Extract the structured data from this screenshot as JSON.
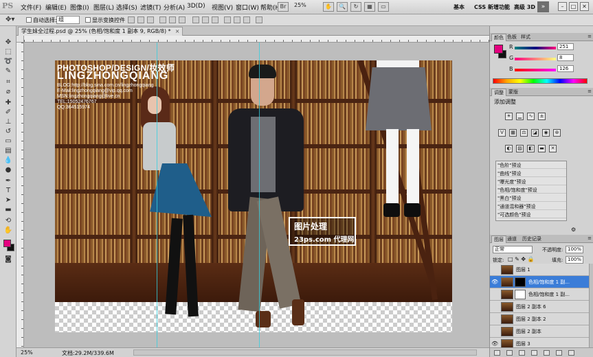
{
  "menubar": {
    "logo": "PS",
    "items": [
      "文件(F)",
      "编辑(E)",
      "图像(I)",
      "图层(L)",
      "选择(S)",
      "滤镜(T)",
      "分析(A)",
      "3D(D)",
      "视图(V)",
      "窗口(W)",
      "帮助(H)"
    ],
    "zoom": "25%",
    "workspaces": [
      "基本",
      "CSS 新增功能",
      "高级 3D"
    ],
    "more": "»",
    "window_buttons": [
      "–",
      "□",
      "✕"
    ]
  },
  "options": {
    "auto_select_label": "自动选择:",
    "auto_select_value": "组",
    "show_transform_label": "显示变换控件"
  },
  "document": {
    "tab_title": "学生妹全过程.psd @ 25% (色相/饱和度 1 副本 9, RGB/8) *",
    "close": "×"
  },
  "artwork": {
    "title": "PHOTOSHOP/DESIGN/妆效师",
    "name": "LINGZHONGQIANG",
    "lines": [
      "BLOG:http://blog.sina.com.cn/lingzhongqiang",
      "E-Mail:lingzhongqiang@vip.qq.com",
      "MSN:lingzhongqiang@live.cn",
      "TEL:15052476767",
      "QQ:364515974"
    ],
    "watermark_title": "图片处理",
    "watermark_sub": "23ps.com 代理网"
  },
  "status": {
    "zoom": "25%",
    "doc": "文档:29.2M/339.6M"
  },
  "panels": {
    "color_tabs": [
      "颜色",
      "色板",
      "样式"
    ],
    "color": {
      "fg": "#e4007f",
      "bg": "#111111",
      "r_label": "R",
      "g_label": "G",
      "b_label": "B",
      "r": "251",
      "g": "8",
      "b": "126"
    },
    "adjust_tabs": [
      "调整",
      "蒙版"
    ],
    "adjust_title": "添加调整",
    "presets": [
      "\"色阶\"预设",
      "\"曲线\"预设",
      "\"曝光度\"预设",
      "\"色相/饱和度\"预设",
      "\"黑白\"预设",
      "\"通道混和器\"预设",
      "\"可选颜色\"预设"
    ],
    "layer_tabs": [
      "图层",
      "通道",
      "历史记录"
    ],
    "blend_mode": "正常",
    "opacity_label": "不透明度:",
    "opacity": "100%",
    "lock_label": "锁定:",
    "fill_label": "填充:",
    "fill": "100%",
    "layers": [
      {
        "name": "图层 1",
        "visible": false,
        "mask": "none",
        "selected": false
      },
      {
        "name": "色相/饱和度 1 副...",
        "visible": true,
        "mask": "black",
        "selected": true
      },
      {
        "name": "色相/饱和度 1 副...",
        "visible": false,
        "mask": "white",
        "selected": false
      },
      {
        "name": "图层 2 副本 6",
        "visible": false,
        "mask": "none",
        "selected": false
      },
      {
        "name": "图层 2 副本 2",
        "visible": false,
        "mask": "none",
        "selected": false
      },
      {
        "name": "图层 2 副本",
        "visible": false,
        "mask": "none",
        "selected": false
      },
      {
        "name": "图层 3",
        "visible": true,
        "mask": "none",
        "selected": false
      }
    ]
  }
}
